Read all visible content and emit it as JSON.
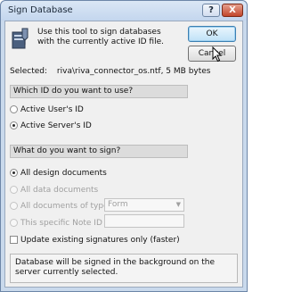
{
  "window": {
    "title": "Sign Database",
    "help_glyph": "?",
    "close_glyph": "X"
  },
  "intro": "Use this tool to sign databases with the currently active ID file.",
  "buttons": {
    "ok": "OK",
    "cancel": "Cancel"
  },
  "selected": {
    "label": "Selected:",
    "value": "riva\\riva_connector_os.ntf, 5 MB bytes"
  },
  "id_section": {
    "heading": "Which ID do you want to use?",
    "options": [
      {
        "label": "Active User's ID",
        "checked": false
      },
      {
        "label": "Active Server's ID",
        "checked": true
      }
    ]
  },
  "sign_section": {
    "heading": "What do you want to sign?",
    "options": [
      {
        "label": "All design documents",
        "checked": true,
        "enabled": true
      },
      {
        "label": "All data documents",
        "checked": false,
        "enabled": false
      },
      {
        "label": "All documents of type",
        "checked": false,
        "enabled": false
      },
      {
        "label": "This specific Note ID",
        "checked": false,
        "enabled": false
      }
    ],
    "type_select_value": "Form",
    "note_id_value": ""
  },
  "update_only": {
    "label": "Update existing signatures only (faster)",
    "checked": false
  },
  "status_text": "Database will be signed in the background on the server currently selected.",
  "icons": {
    "app": "signature-tool-icon",
    "cursor": "mouse-pointer-icon"
  }
}
